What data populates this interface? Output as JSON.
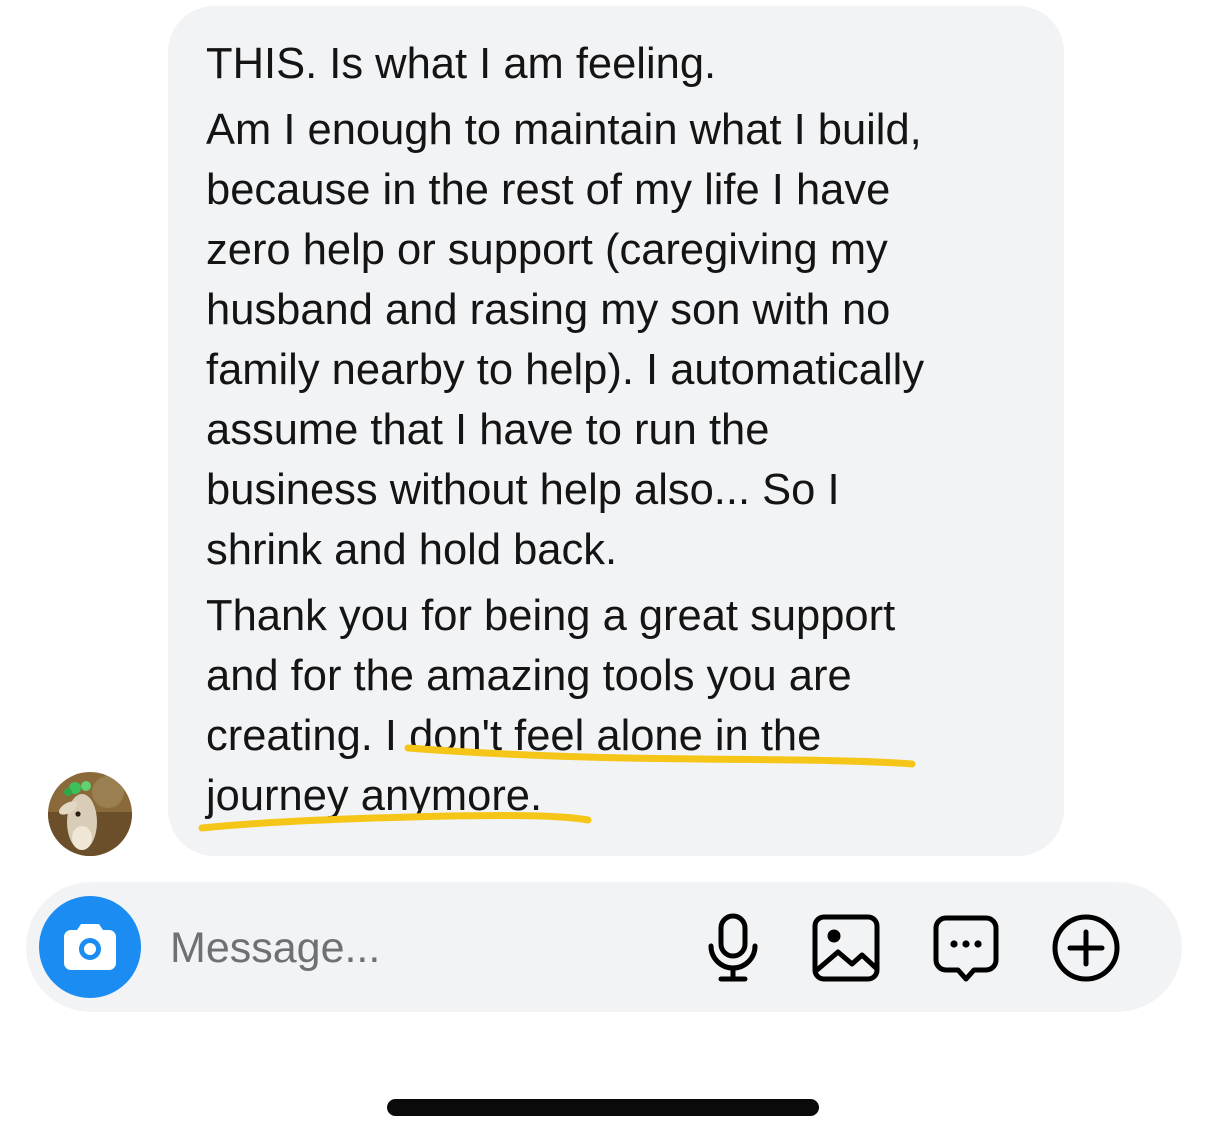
{
  "conversation": {
    "message_lines": [
      "THIS. Is what I am feeling.",
      "Am I enough to maintain what I build,",
      "because in the rest of my life I have",
      "zero help or support (caregiving my",
      "husband and rasing my son with no",
      "family nearby to help). I automatically",
      "assume that I have to run the",
      "business without help also... So I",
      "shrink and hold back.",
      "Thank you for being a great support",
      "and for the amazing tools you are",
      "creating. I don't feel alone in the",
      "journey anymore."
    ],
    "highlighted_phrase": "I don't feel alone in the journey anymore.",
    "highlight_color": "#f5c518",
    "bubble_color": "#f2f3f5"
  },
  "composer": {
    "placeholder": "Message...",
    "camera_icon": "camera-icon",
    "accent_color": "#1a8cf2",
    "tools": [
      "microphone-icon",
      "gallery-icon",
      "sticker-chat-icon",
      "plus-circle-icon"
    ]
  }
}
